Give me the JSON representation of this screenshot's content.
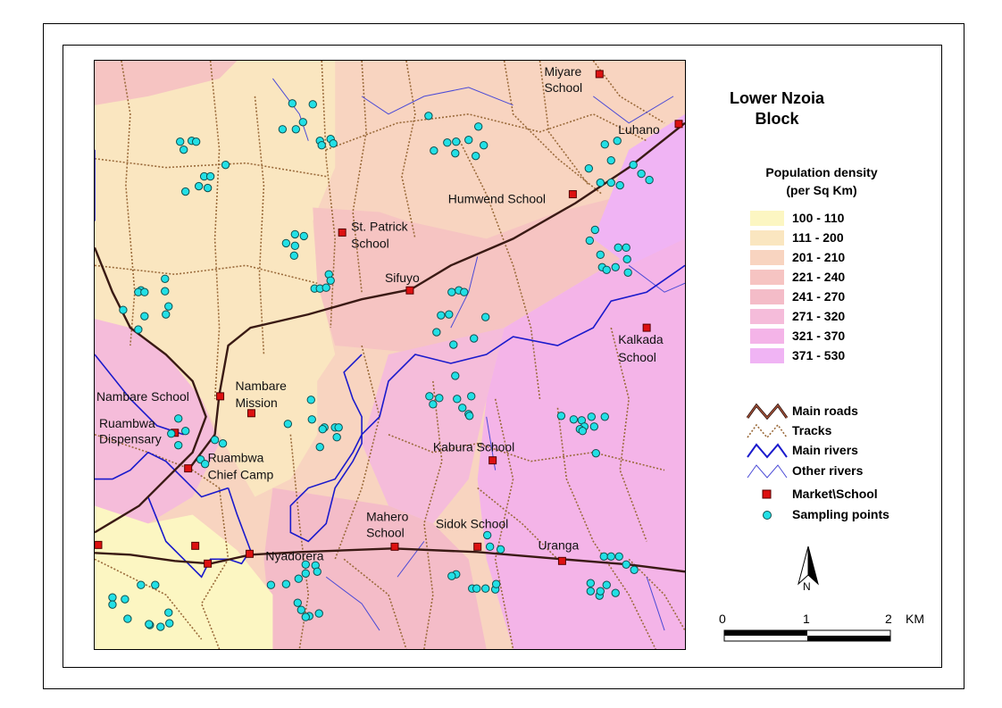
{
  "map": {
    "title_line1": "Lower Nzoia",
    "title_line2": "Block",
    "place_labels": [
      {
        "id": "miyare",
        "lines": [
          "Miyare",
          "School"
        ]
      },
      {
        "id": "luhano",
        "lines": [
          "Luhano"
        ]
      },
      {
        "id": "humwend",
        "lines": [
          "Humwend School"
        ]
      },
      {
        "id": "st-patrick",
        "lines": [
          "St. Patrick",
          "School"
        ]
      },
      {
        "id": "sifuyo",
        "lines": [
          "Sifuyo"
        ]
      },
      {
        "id": "kalkada",
        "lines": [
          "Kalkada",
          "School"
        ]
      },
      {
        "id": "nambare-school",
        "lines": [
          "Nambare School"
        ]
      },
      {
        "id": "nambare-mission",
        "lines": [
          "Nambare",
          "Mission"
        ]
      },
      {
        "id": "ruambwa-dispensary",
        "lines": [
          "Ruambwa",
          "Dispensary"
        ]
      },
      {
        "id": "ruambwa-chief-camp",
        "lines": [
          "Ruambwa",
          "Chief Camp"
        ]
      },
      {
        "id": "kabura",
        "lines": [
          "Kabura School"
        ]
      },
      {
        "id": "mahero",
        "lines": [
          "Mahero",
          "School"
        ]
      },
      {
        "id": "sidok",
        "lines": [
          "Sidok School"
        ]
      },
      {
        "id": "uranga",
        "lines": [
          "Uranga"
        ]
      },
      {
        "id": "nyadorera",
        "lines": [
          "Nyadorera"
        ]
      }
    ]
  },
  "legend": {
    "population_title_line1": "Population density",
    "population_title_line2": "(per Sq Km)",
    "classes": [
      {
        "label": "100 - 110",
        "color": "#fcf6c2"
      },
      {
        "label": "111 - 200",
        "color": "#fae6c0"
      },
      {
        "label": "201 - 210",
        "color": "#f8d4c0"
      },
      {
        "label": "221 - 240",
        "color": "#f6c4c2"
      },
      {
        "label": "241 - 270",
        "color": "#f4bcc8"
      },
      {
        "label": "271 - 320",
        "color": "#f5bcda"
      },
      {
        "label": "321 - 370",
        "color": "#f4b4e8"
      },
      {
        "label": "371 - 530",
        "color": "#f0b4f4"
      }
    ],
    "symbols": [
      {
        "label": "Main roads",
        "icon": "main-road-icon"
      },
      {
        "label": "Tracks",
        "icon": "track-icon"
      },
      {
        "label": "Main rivers",
        "icon": "main-river-icon"
      },
      {
        "label": "Other rivers",
        "icon": "other-river-icon"
      },
      {
        "label": "Market\\School",
        "icon": "market-school-icon"
      },
      {
        "label": "Sampling points",
        "icon": "sampling-point-icon"
      }
    ],
    "north_label": "N",
    "scale": {
      "ticks": [
        "0",
        "1",
        "2"
      ],
      "unit": "KM"
    }
  },
  "colors": {
    "road": "#3a1a14",
    "track": "#9a6a3a",
    "main_river": "#1a1acc",
    "other_river": "#4a4ad6",
    "market": "#dd1111",
    "sampling": "#22e0e6"
  }
}
